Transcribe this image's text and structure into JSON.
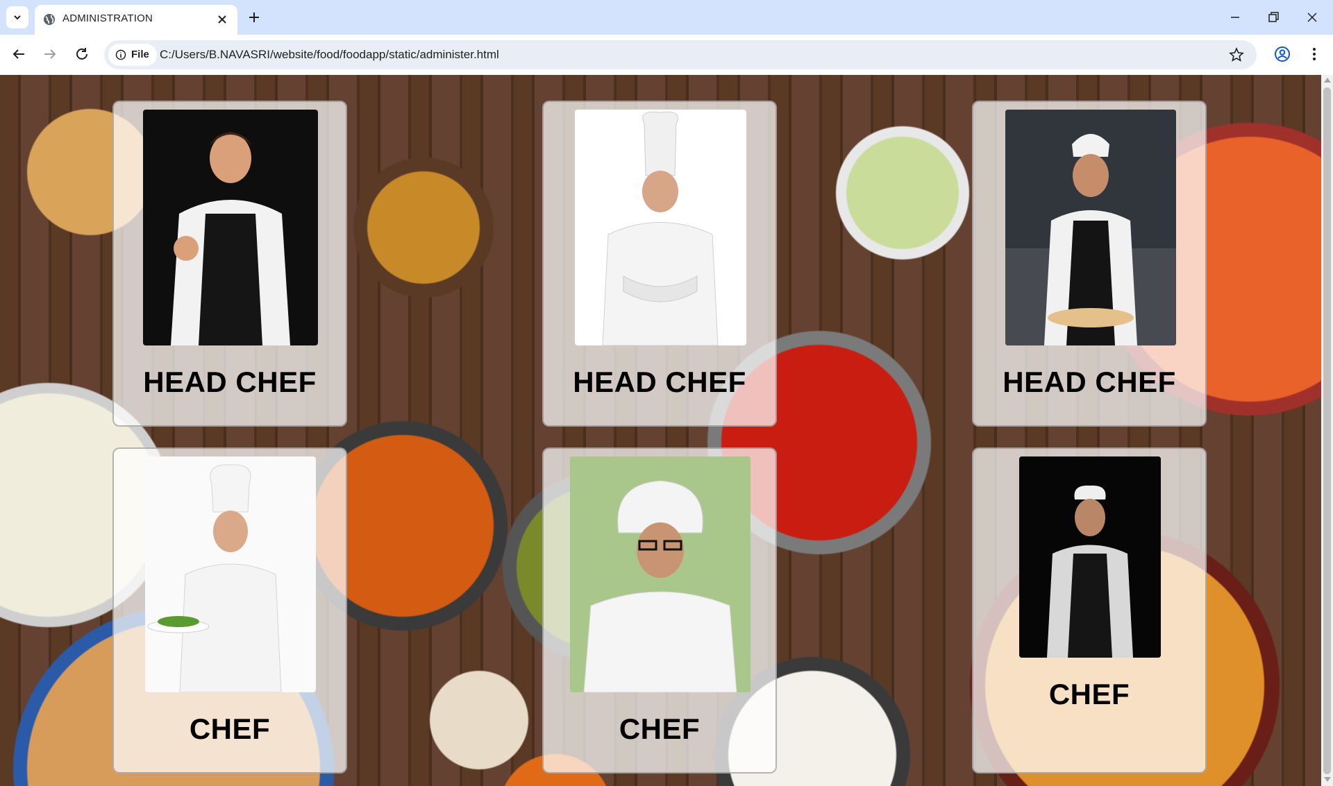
{
  "browser": {
    "tab_title": "ADMINISTRATION",
    "chip_label": "File",
    "url": "C:/Users/B.NAVASRI/website/food/foodapp/static/administer.html"
  },
  "colors": {
    "tabstrip": "#d3e3fd",
    "omnibox": "#e9eef6",
    "card_bg": "rgba(255,255,255,0.72)"
  },
  "staff": [
    {
      "role": "HEAD CHEF",
      "photo": "male-chef-thumbs-up-photo"
    },
    {
      "role": "HEAD CHEF",
      "photo": "male-chef-arms-crossed-photo"
    },
    {
      "role": "HEAD CHEF",
      "photo": "female-chef-pizza-photo"
    },
    {
      "role": "CHEF",
      "photo": "chef-holding-salad-photo"
    },
    {
      "role": "CHEF",
      "photo": "chef-with-glasses-photo"
    },
    {
      "role": "CHEF",
      "photo": "senior-chef-photo"
    }
  ]
}
